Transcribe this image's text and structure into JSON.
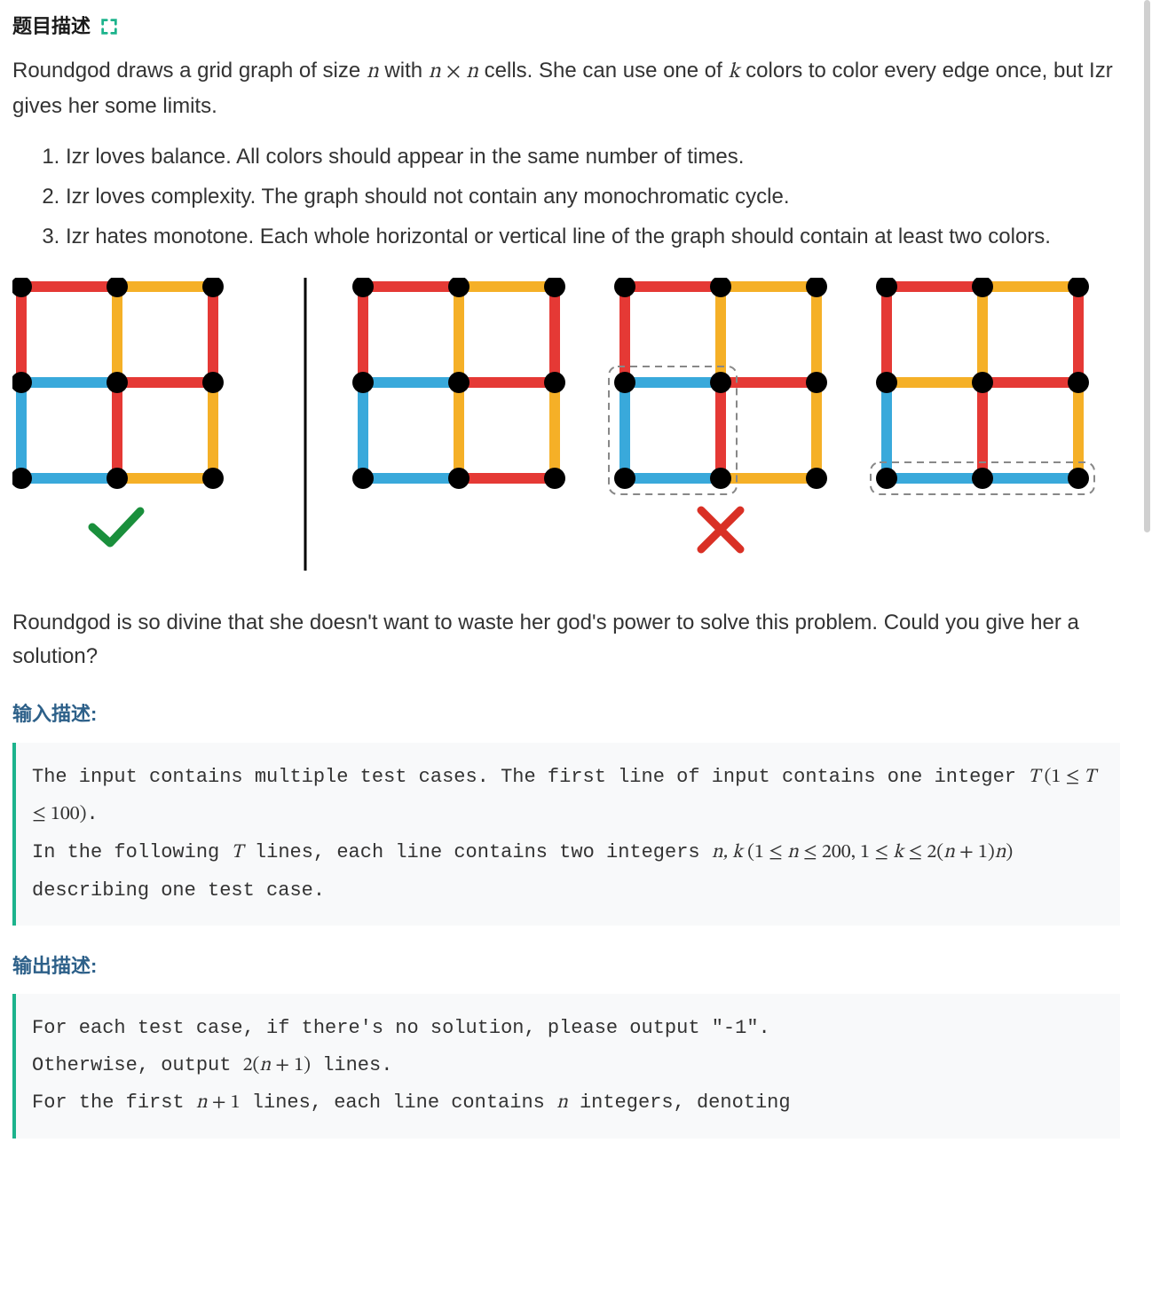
{
  "title": "题目描述",
  "intro_parts": {
    "a": "Roundgod draws a grid graph of size ",
    "b": " with ",
    "c": " cells. She can use one of ",
    "d": " colors to color every edge once, but Izr gives her some limits."
  },
  "rules": [
    "Izr loves balance. All colors should appear in the same number of times.",
    "Izr loves complexity. The graph should not contain any monochromatic cycle.",
    "Izr hates monotone. Each whole horizontal or vertical line of the graph should contain at least two colors."
  ],
  "outro": "Roundgod is so divine that she doesn't want to waste her god's power to solve this problem. Could you give her a solution?",
  "input_header": "输入描述:",
  "output_header": "输出描述:",
  "input_desc": {
    "l1a": "The input contains multiple test cases. The first line of input contains one integer ",
    "l1m": "T (1 ≤ T ≤ 100)",
    "l1b": ".",
    "l2a": "In the following ",
    "l2m1": "T",
    "l2b": " lines, each line contains two integers ",
    "l2m2": "n, k (1 ≤ n ≤ 200, 1 ≤ k ≤ 2(n + 1)n)",
    "l2c": " describing one test case."
  },
  "output_desc": {
    "l1": "For each test case, if there's no solution, please output \"-1\".",
    "l2a": "Otherwise, output ",
    "l2m": "2(n + 1)",
    "l2b": " lines.",
    "l3a": "For the first ",
    "l3m1": "n + 1",
    "l3b": " lines, each line contains ",
    "l3m2": "n",
    "l3c": " integers, denoting"
  },
  "colors": {
    "red": "#e53935",
    "blue": "#39a9db",
    "yellow": "#f5b027",
    "node": "#000000",
    "check": "#1a8f3c",
    "cross": "#d93025"
  },
  "chart_data": [
    {
      "type": "grid-graph",
      "label": "valid",
      "n": 2,
      "horizontal": [
        [
          "red",
          "yellow"
        ],
        [
          "blue",
          "red"
        ],
        [
          "blue",
          "yellow"
        ]
      ],
      "vertical": [
        [
          "red",
          "yellow",
          "red"
        ],
        [
          "blue",
          "red",
          "yellow"
        ]
      ]
    },
    {
      "type": "grid-graph",
      "label": "invalid-1",
      "n": 2,
      "horizontal": [
        [
          "red",
          "yellow"
        ],
        [
          "blue",
          "red"
        ],
        [
          "blue",
          "red"
        ]
      ],
      "vertical": [
        [
          "red",
          "yellow",
          "red"
        ],
        [
          "blue",
          "yellow",
          "yellow"
        ]
      ]
    },
    {
      "type": "grid-graph",
      "label": "invalid-2",
      "n": 2,
      "horizontal": [
        [
          "red",
          "yellow"
        ],
        [
          "blue",
          "red"
        ],
        [
          "blue",
          "yellow"
        ]
      ],
      "vertical": [
        [
          "red",
          "yellow",
          "yellow"
        ],
        [
          "blue",
          "red",
          "yellow"
        ]
      ],
      "highlight_box": {
        "r0": 1,
        "c0": 0,
        "r1": 2,
        "c1": 1
      }
    },
    {
      "type": "grid-graph",
      "label": "invalid-3",
      "n": 2,
      "horizontal": [
        [
          "red",
          "yellow"
        ],
        [
          "yellow",
          "red"
        ],
        [
          "blue",
          "blue"
        ]
      ],
      "vertical": [
        [
          "red",
          "yellow",
          "red"
        ],
        [
          "blue",
          "red",
          "yellow"
        ]
      ],
      "highlight_box": {
        "r0": 2,
        "c0": 0,
        "r1": 2,
        "c1": 2
      }
    }
  ]
}
